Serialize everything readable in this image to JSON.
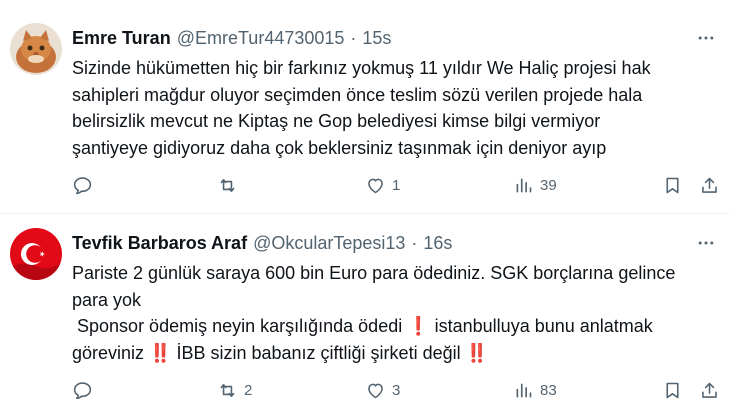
{
  "tweets": [
    {
      "author_name": "Emre Turan",
      "handle": "@EmreTur44730015",
      "separator": "·",
      "time": "15s",
      "text": "Sizinde hükümetten hiç bir farkınız yokmuş 11 yıldır We Haliç projesi hak\nsahipleri mağdur oluyor seçimden önce teslim sözü verilen projede hala\nbelirsizlik mevcut ne Kiptaş ne Gop belediyesi kimse bilgi vermiyor\nşantiyeye gidiyoruz daha çok beklersiniz taşınmak için deniyor ayıp",
      "replies": "",
      "retweets": "",
      "likes": "1",
      "views": "39",
      "avatar_icon": "cat-photo-avatar"
    },
    {
      "author_name": "Tevfik Barbaros Araf",
      "handle": "@OkcularTepesi13",
      "separator": "·",
      "time": "16s",
      "text_line_1": "Pariste 2 günlük saraya 600 bin Euro para ödediniz. SGK borçlarına gelince",
      "text_line_2": "para yok",
      "text_line_3a": " Sponsor ödemiş neyin karşılığında ödedi ",
      "mark_1": "❗",
      "text_line_3b": " istanbulluya bunu anlatmak",
      "text_line_4a": "göreviniz ",
      "mark_2": "‼️",
      "text_line_4b": " İBB sizin babanız çiftliği şirketi değil ",
      "mark_3": "‼️",
      "replies": "",
      "retweets": "2",
      "likes": "3",
      "views": "83",
      "avatar_icon": "turkish-flag-avatar"
    }
  ],
  "colors": {
    "text": "#0f1419",
    "secondary": "#536471",
    "divider": "#eff3f4",
    "flag_red": "#e30a17"
  },
  "icons": [
    "reply-icon",
    "retweet-icon",
    "like-icon",
    "views-icon",
    "bookmark-icon",
    "share-icon",
    "more-icon"
  ]
}
